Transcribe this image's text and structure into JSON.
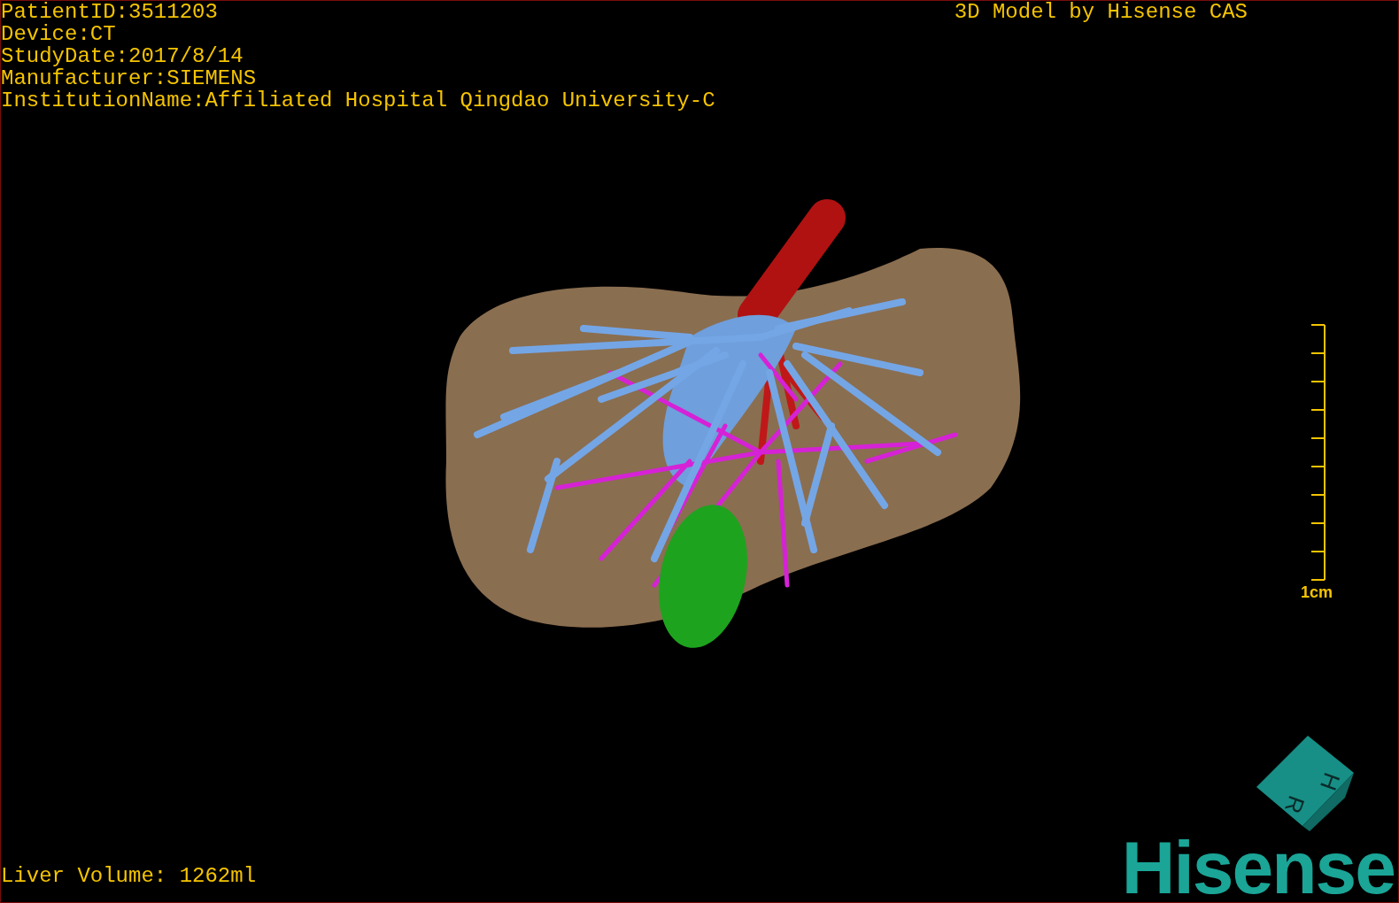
{
  "info_lines": [
    "PatientID:3511203",
    "Device:CT",
    "StudyDate:2017/8/14",
    "Manufacturer:SIEMENS",
    "InstitutionName:Affiliated Hospital Qingdao University-C"
  ],
  "title": "3D Model by Hisense CAS",
  "scale_bar": {
    "label": "1cm"
  },
  "liver_volume": "Liver Volume: 1262ml",
  "orientation_cube": {
    "faces": [
      "H",
      "R"
    ]
  },
  "logo": "Hisense"
}
